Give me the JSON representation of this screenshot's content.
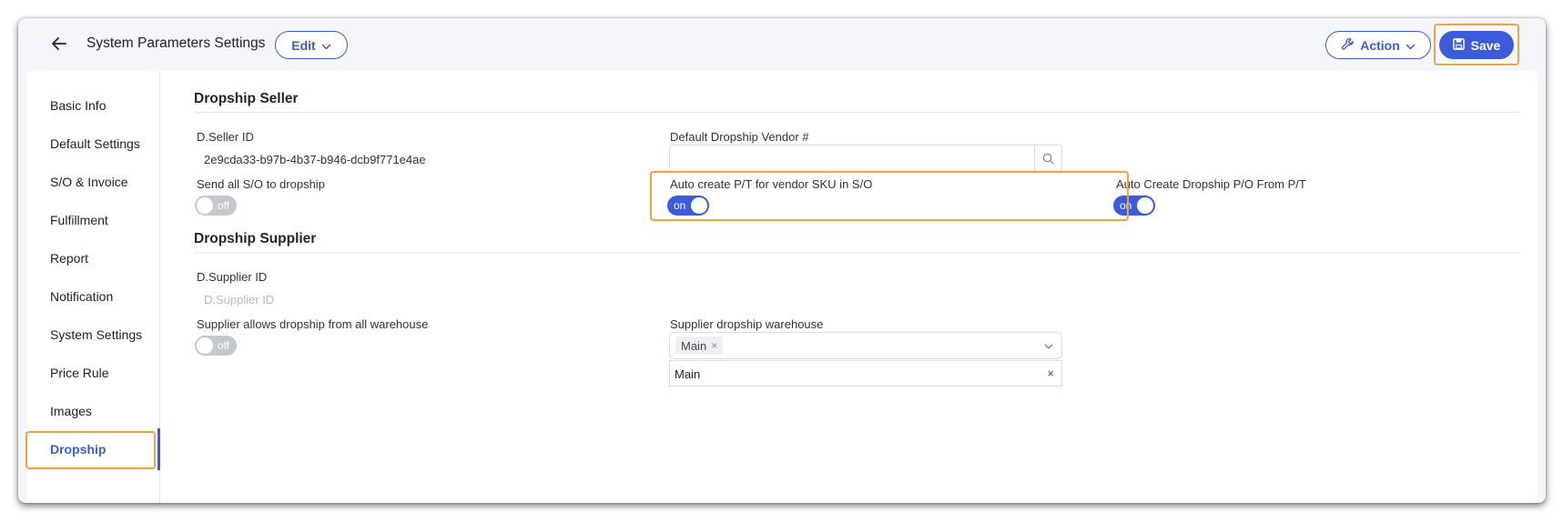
{
  "header": {
    "title": "System Parameters Settings",
    "edit_label": "Edit",
    "action_label": "Action",
    "save_label": "Save"
  },
  "sidebar": {
    "items": [
      {
        "label": "Basic Info"
      },
      {
        "label": "Default Settings"
      },
      {
        "label": "S/O & Invoice"
      },
      {
        "label": "Fulfillment"
      },
      {
        "label": "Report"
      },
      {
        "label": "Notification"
      },
      {
        "label": "System Settings"
      },
      {
        "label": "Price Rule"
      },
      {
        "label": "Images"
      },
      {
        "label": "Dropship",
        "active": true
      }
    ]
  },
  "dropship_seller": {
    "title": "Dropship Seller",
    "seller_id_label": "D.Seller ID",
    "seller_id_value": "2e9cda33-b97b-4b37-b946-dcb9f771e4ae",
    "vendor_label": "Default Dropship Vendor #",
    "vendor_value": "",
    "send_all_label": "Send all S/O to dropship",
    "send_all_state": "off",
    "auto_pt_label": "Auto create P/T for vendor SKU in S/O",
    "auto_pt_state": "on",
    "auto_po_label": "Auto Create Dropship P/O From P/T",
    "auto_po_state": "on"
  },
  "dropship_supplier": {
    "title": "Dropship Supplier",
    "supplier_id_label": "D.Supplier ID",
    "supplier_id_placeholder": "D.Supplier ID",
    "allow_all_label": "Supplier allows dropship from all warehouse",
    "allow_all_state": "off",
    "warehouse_label": "Supplier dropship warehouse",
    "warehouse_tag": "Main",
    "warehouse_row": "Main"
  },
  "colors": {
    "accent": "#3b5bdb",
    "highlight": "#f0a53a"
  }
}
